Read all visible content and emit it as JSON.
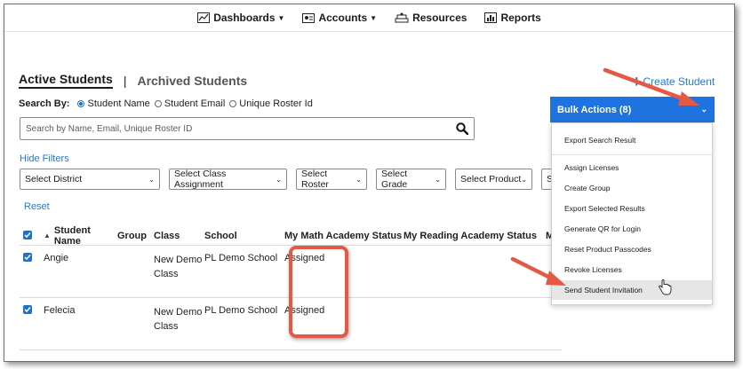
{
  "nav": {
    "items": [
      {
        "label": "Dashboards",
        "icon": "chart-line-icon",
        "has_caret": true
      },
      {
        "label": "Accounts",
        "icon": "id-card-icon",
        "has_caret": true
      },
      {
        "label": "Resources",
        "icon": "book-stack-icon",
        "has_caret": false
      },
      {
        "label": "Reports",
        "icon": "bar-chart-icon",
        "has_caret": false
      }
    ]
  },
  "tabs": {
    "active": "Active Students",
    "separator": "|",
    "inactive": "Archived Students"
  },
  "create_student": {
    "plus": "+",
    "label": "Create Student"
  },
  "search_by": {
    "label": "Search By:",
    "options": [
      {
        "label": "Student Name",
        "selected": true
      },
      {
        "label": "Student Email",
        "selected": false
      },
      {
        "label": "Unique Roster Id",
        "selected": false
      }
    ]
  },
  "search": {
    "placeholder": "Search by Name, Email, Unique Roster ID"
  },
  "hide_filters": "Hide Filters",
  "filters": [
    "Select District",
    "Select Class Assignment",
    "Select Roster",
    "Select Grade",
    "Select Product",
    "Se"
  ],
  "reset": "Reset",
  "table": {
    "columns": [
      "Student Name",
      "Group",
      "Class",
      "School",
      "My Math Academy Status",
      "My Reading Academy Status",
      "M"
    ],
    "rows": [
      {
        "name": "Angie",
        "group": "",
        "class": "New Demo Class",
        "school": "PL Demo School",
        "math_status": "Assigned",
        "reading_status": ""
      },
      {
        "name": "Felecia",
        "group": "",
        "class": "New Demo Class",
        "school": "PL Demo School",
        "math_status": "Assigned",
        "reading_status": ""
      }
    ]
  },
  "bulk_actions": {
    "label": "Bulk Actions (8)",
    "menu": [
      "Export Search Result",
      "Assign Licenses",
      "Create Group",
      "Export Selected Results",
      "Generate QR for Login",
      "Reset Product Passcodes",
      "Revoke Licenses",
      "Send Student Invitation"
    ],
    "active_item": "Send Student Invitation"
  },
  "colors": {
    "accent": "#1e73e0",
    "link": "#2478d4",
    "annotation": "#e55846"
  }
}
